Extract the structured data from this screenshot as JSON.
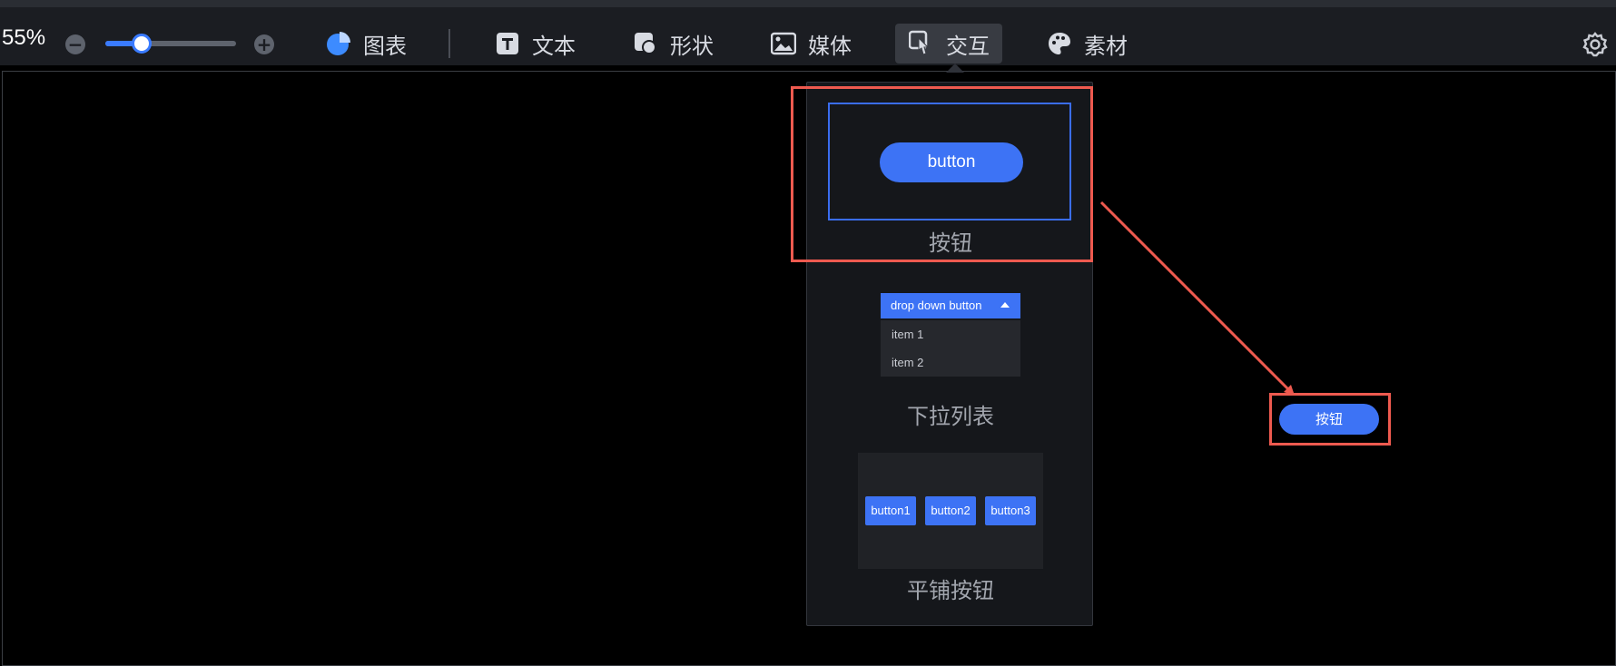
{
  "toolbar": {
    "zoom_percent": "55%",
    "zoom_slider_fraction": 0.2,
    "tools": [
      {
        "label": "图表",
        "icon": "pie-chart-icon",
        "active": false
      },
      {
        "label": "文本",
        "icon": "text-icon",
        "active": false
      },
      {
        "label": "形状",
        "icon": "shape-icon",
        "active": false
      },
      {
        "label": "媒体",
        "icon": "image-icon",
        "active": false
      },
      {
        "label": "交互",
        "icon": "pointer-hand-icon",
        "active": true
      },
      {
        "label": "素材",
        "icon": "palette-icon",
        "active": false
      }
    ],
    "settings_icon": "gear-icon"
  },
  "panel": {
    "button_component": {
      "preview_label": "button",
      "name": "按钮"
    },
    "dropdown_component": {
      "preview_label": "drop down button",
      "items": [
        "item 1",
        "item 2"
      ],
      "name": "下拉列表"
    },
    "tiled_component": {
      "buttons": [
        "button1",
        "button2",
        "button3"
      ],
      "name": "平铺按钮"
    }
  },
  "canvas": {
    "placed_button_label": "按钮"
  },
  "colors": {
    "accent": "#3d73f5",
    "highlight": "#ee5a4f",
    "toolbar_bg": "#1b1d22",
    "panel_bg": "#15171b"
  }
}
